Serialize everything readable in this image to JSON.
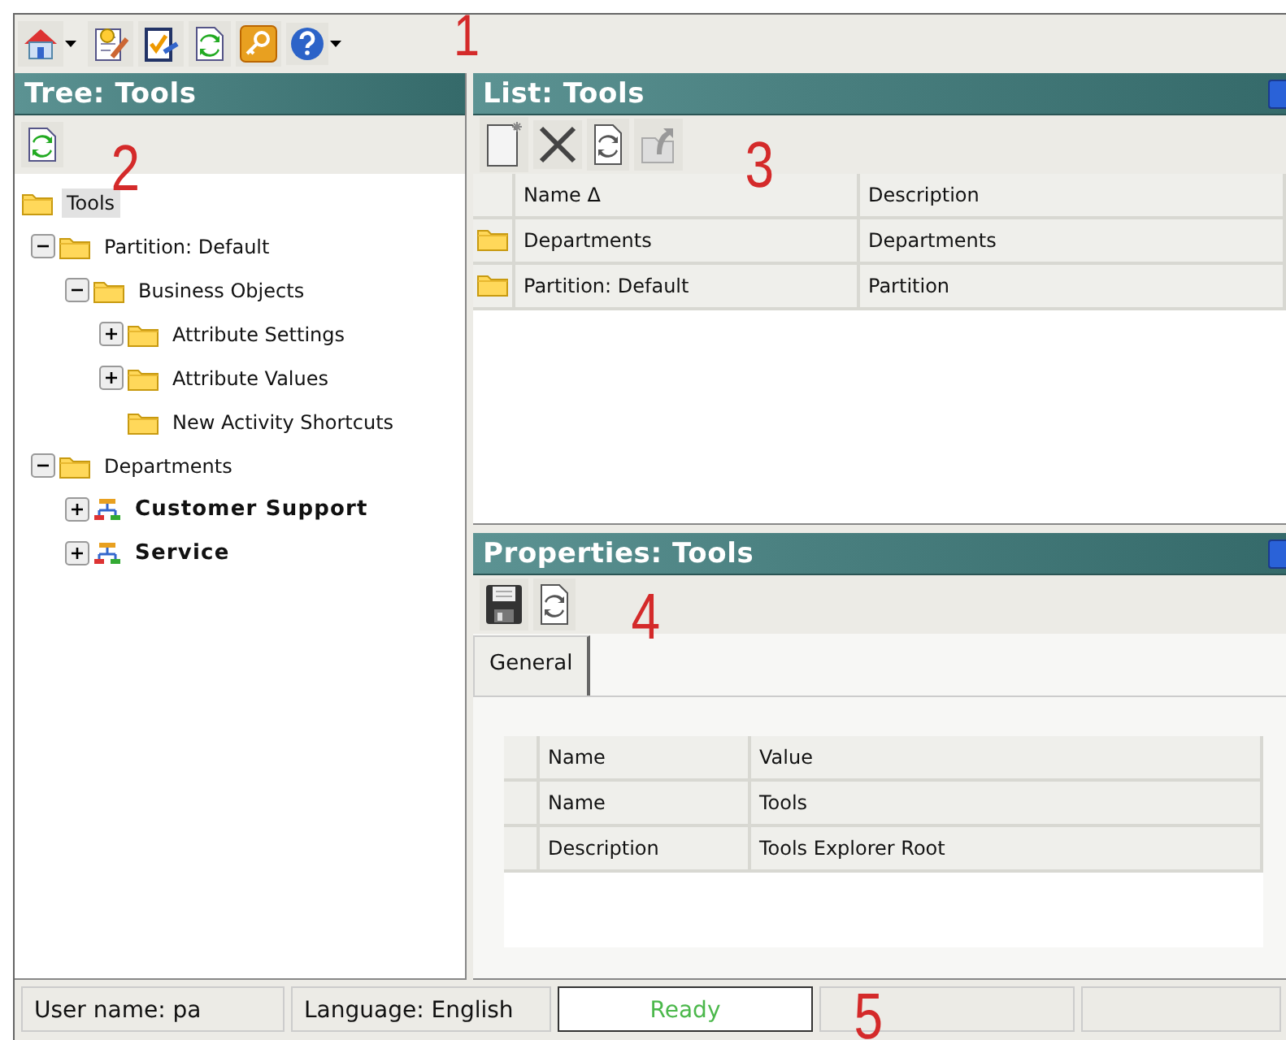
{
  "callouts": [
    "1",
    "2",
    "3",
    "4",
    "5"
  ],
  "tree_panel": {
    "title": "Tree: Tools",
    "items": [
      {
        "label": "Tools",
        "kind": "folder",
        "selected": true,
        "children": [
          {
            "label": "Partition: Default",
            "kind": "folder",
            "selected": false,
            "expanded": true,
            "children": [
              {
                "label": "Business Objects",
                "kind": "folder",
                "selected": false,
                "expanded": true,
                "children": [
                  {
                    "label": "Attribute Settings",
                    "kind": "folder",
                    "selected": false,
                    "expanded": false
                  },
                  {
                    "label": "Attribute Values",
                    "kind": "folder",
                    "selected": false,
                    "expanded": false
                  },
                  {
                    "label": "New Activity Shortcuts",
                    "kind": "folder",
                    "selected": false
                  }
                ]
              }
            ]
          },
          {
            "label": "Departments",
            "kind": "folder",
            "selected": false,
            "expanded": true,
            "children": [
              {
                "label": "Customer Support",
                "kind": "org",
                "selected": false,
                "expanded": false
              },
              {
                "label": "Service",
                "kind": "org",
                "selected": false,
                "expanded": false
              }
            ]
          }
        ]
      }
    ]
  },
  "list_panel": {
    "title": "List: Tools",
    "columns": [
      "Name Δ",
      "Description"
    ],
    "rows": [
      {
        "cells": [
          "Departments",
          "Departments"
        ]
      },
      {
        "cells": [
          "Partition: Default",
          "Partition"
        ]
      }
    ]
  },
  "properties_panel": {
    "title": "Properties: Tools",
    "tabs": [
      {
        "label": "General",
        "selected": true
      }
    ],
    "table": {
      "columns": [
        "Name",
        "Value"
      ],
      "rows": [
        [
          "Name",
          "Tools"
        ],
        [
          "Description",
          "Tools Explorer Root"
        ]
      ]
    }
  },
  "status_bar": {
    "user": "User name: pa",
    "language": "Language: English",
    "status": "Ready"
  }
}
